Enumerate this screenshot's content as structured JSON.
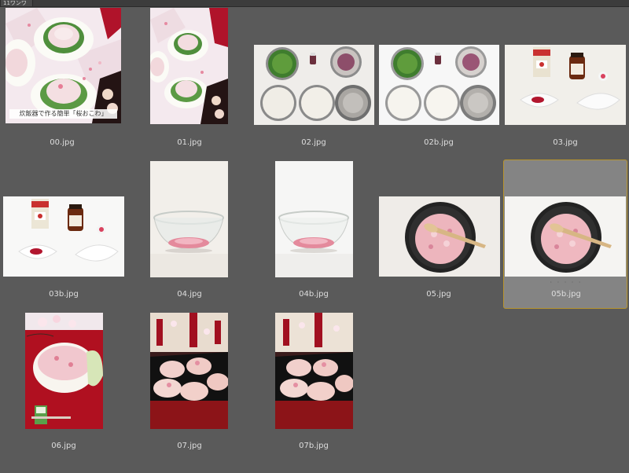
{
  "window": {
    "tab_label": "11ワンワ"
  },
  "thumbnails": [
    {
      "filename": "00.jpg",
      "image": "sakura-okowa-plates-with-title",
      "overlay_text": "炊飯器で作る簡単「桜おこわ」"
    },
    {
      "filename": "01.jpg",
      "image": "sakura-okowa-plates"
    },
    {
      "filename": "02.jpg",
      "image": "ingredients-bowls"
    },
    {
      "filename": "02b.jpg",
      "image": "ingredients-bowls-white"
    },
    {
      "filename": "03.jpg",
      "image": "food-coloring-dishes"
    },
    {
      "filename": "03b.jpg",
      "image": "food-coloring-dishes-white"
    },
    {
      "filename": "04.jpg",
      "image": "glass-bowl-pink-rice"
    },
    {
      "filename": "04b.jpg",
      "image": "glass-bowl-pink-rice-white"
    },
    {
      "filename": "05.jpg",
      "image": "rice-cooker-pot-spatula"
    },
    {
      "filename": "05b.jpg",
      "image": "rice-cooker-pot-spatula-white",
      "selected": true
    },
    {
      "filename": "06.jpg",
      "image": "okowa-bowl-red-tray"
    },
    {
      "filename": "07.jpg",
      "image": "okowa-balls-lacquer-box"
    },
    {
      "filename": "07b.jpg",
      "image": "okowa-balls-lacquer-box-2"
    }
  ],
  "selection_dots": "· · · · ·",
  "colors": {
    "background": "#5a5a5a",
    "selection_border": "#b8952e",
    "selection_fill": "#848484",
    "caption": "#dedede"
  }
}
